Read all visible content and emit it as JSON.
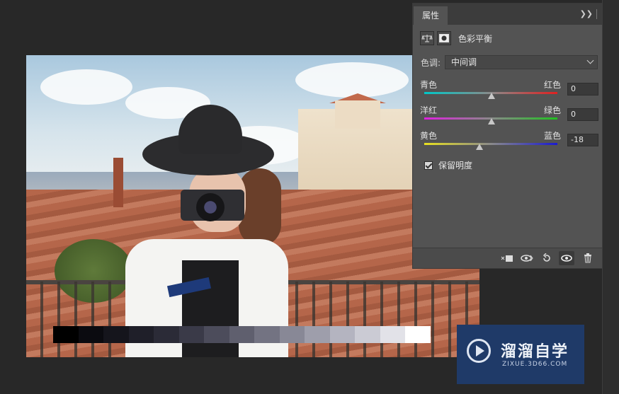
{
  "panel": {
    "tab_label": "属性",
    "adjustment_title": "色彩平衡",
    "tone": {
      "label": "色调:",
      "selected": "中间调"
    },
    "sliders": [
      {
        "left_label": "青色",
        "right_label": "红色",
        "value": "0",
        "gradient_start": "#00c8c8",
        "gradient_end": "#e02020"
      },
      {
        "left_label": "洋红",
        "right_label": "绿色",
        "value": "0",
        "gradient_start": "#e020e0",
        "gradient_end": "#20c020"
      },
      {
        "left_label": "黄色",
        "right_label": "蓝色",
        "value": "-18",
        "gradient_start": "#e8e020",
        "gradient_end": "#1a1ad0"
      }
    ],
    "preserve_luminosity": {
      "label": "保留明度",
      "checked": true
    },
    "footer_icons": [
      "clip-to-layer-icon",
      "view-previous-icon",
      "reset-icon",
      "visibility-icon",
      "delete-icon"
    ]
  },
  "grayscale_ramp": [
    "#000000",
    "#0b0b10",
    "#15151c",
    "#1f1f29",
    "#2b2b37",
    "#3a3a48",
    "#4c4c5b",
    "#5f5f6e",
    "#737382",
    "#888896",
    "#9e9eab",
    "#b4b4c0",
    "#cbcbd4",
    "#e2e2e8",
    "#ffffff"
  ],
  "watermark": {
    "title": "溜溜自学",
    "subtitle": "ZIXUE.3D66.COM"
  }
}
